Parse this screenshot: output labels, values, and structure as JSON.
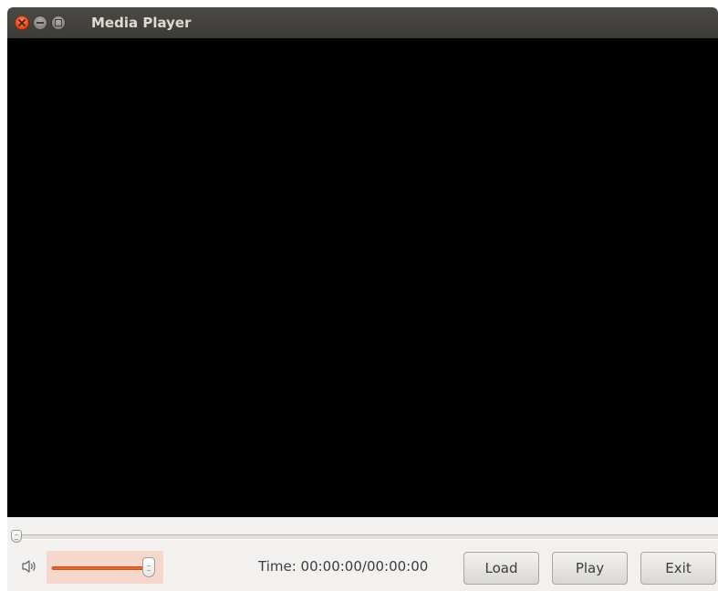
{
  "window": {
    "title": "Media Player"
  },
  "controls": {
    "seek_position_fraction": 0.0,
    "volume_level_fraction": 1.0,
    "time_label": "Time: 00:00:00/00:00:00",
    "buttons": {
      "load": "Load",
      "play": "Play",
      "exit": "Exit"
    }
  },
  "icons": {
    "close": "close-icon",
    "minimize": "minimize-icon",
    "maximize": "maximize-icon",
    "volume": "speaker-icon"
  },
  "colors": {
    "accent": "#e8672e",
    "titlebar": "#3c3b37",
    "close_button": "#df4a16",
    "video_background": "#000000"
  }
}
